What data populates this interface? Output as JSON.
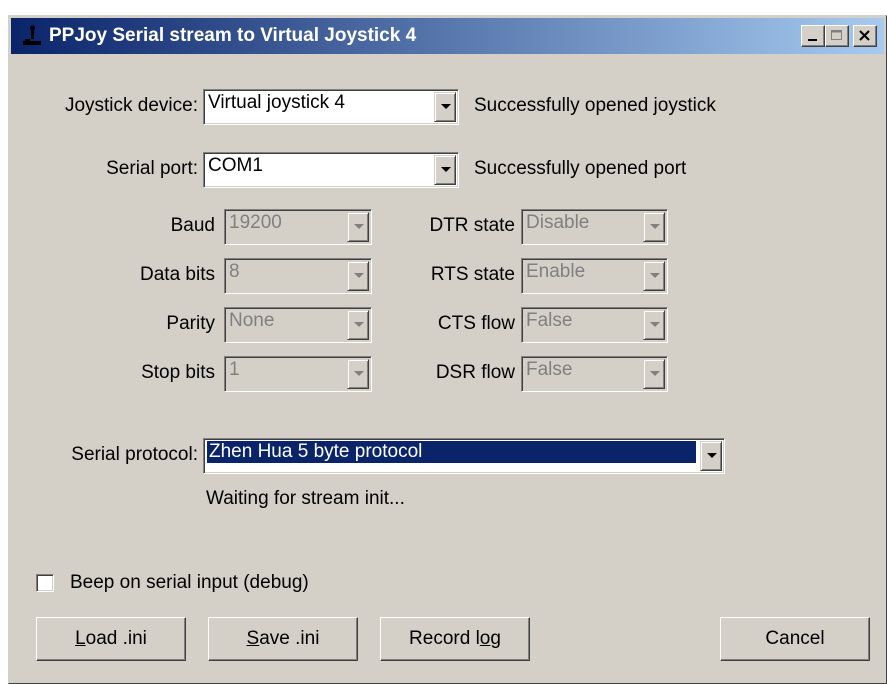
{
  "window": {
    "title": "PPJoy Serial stream to Virtual Joystick 4"
  },
  "joystick": {
    "label": "Joystick device:",
    "value": "Virtual joystick 4",
    "status": "Successfully opened joystick"
  },
  "port": {
    "label": "Serial port:",
    "value": "COM1",
    "status": "Successfully opened port"
  },
  "settings": {
    "baud": {
      "label": "Baud",
      "value": "19200"
    },
    "data_bits": {
      "label": "Data bits",
      "value": "8"
    },
    "parity": {
      "label": "Parity",
      "value": "None"
    },
    "stop_bits": {
      "label": "Stop bits",
      "value": "1"
    },
    "dtr": {
      "label": "DTR state",
      "value": "Disable"
    },
    "rts": {
      "label": "RTS state",
      "value": "Enable"
    },
    "cts": {
      "label": "CTS flow",
      "value": "False"
    },
    "dsr": {
      "label": "DSR flow",
      "value": "False"
    }
  },
  "protocol": {
    "label": "Serial protocol:",
    "value": "Zhen Hua 5 byte protocol",
    "status": "Waiting for stream init..."
  },
  "beep": {
    "label": "Beep on serial input (debug)",
    "checked": false
  },
  "buttons": {
    "load": {
      "accel": "L",
      "rest": "oad .ini"
    },
    "save": {
      "accel": "S",
      "rest": "ave .ini"
    },
    "record": {
      "pre": "Record l",
      "accel": "o",
      "post": "g"
    },
    "cancel": "Cancel"
  },
  "icons": {
    "app": "joystick-icon",
    "minimize": "minimize-icon",
    "maximize": "maximize-icon",
    "close": "close-icon",
    "dropdown": "chevron-down-icon"
  },
  "colors": {
    "titlebar_start": "#0a246a",
    "titlebar_end": "#a6caf0",
    "face": "#d4d0c8",
    "selection": "#0a246a"
  }
}
